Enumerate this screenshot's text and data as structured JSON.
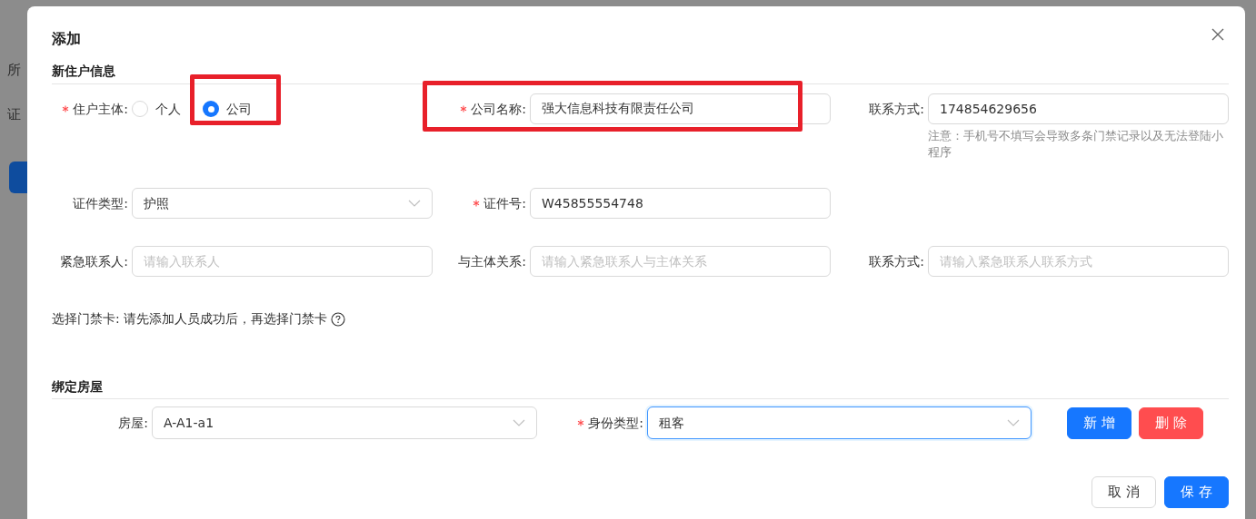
{
  "background": {
    "labels": [
      "所",
      "证"
    ]
  },
  "dialog": {
    "title": "添加",
    "resident": {
      "heading": "新住户信息",
      "rows": [
        [
          {
            "kind": "radio",
            "label": "住户主体:",
            "required": true,
            "options": [
              {
                "label": "个人",
                "selected": false,
                "highlighted": false
              },
              {
                "label": "公司",
                "selected": true,
                "highlighted": true
              }
            ]
          },
          {
            "kind": "input",
            "label": "公司名称:",
            "required": true,
            "value": "强大信息科技有限责任公司",
            "highlighted": true
          },
          {
            "kind": "input",
            "label": "联系方式:",
            "required": false,
            "value": "174854629656",
            "note": "注意：手机号不填写会导致多条门禁记录以及无法登陆小程序",
            "highlighted": false
          }
        ],
        [
          {
            "kind": "select",
            "label": "证件类型:",
            "required": false,
            "value": "护照",
            "highlighted": false
          },
          {
            "kind": "input",
            "label": "证件号:",
            "required": true,
            "value": "W45855554748",
            "highlighted": false
          }
        ],
        [
          {
            "kind": "input",
            "label": "紧急联系人:",
            "required": false,
            "placeholder": "请输入联系人",
            "highlighted": false
          },
          {
            "kind": "input",
            "label": "与主体关系:",
            "required": false,
            "placeholder": "请输入紧急联系人与主体关系",
            "highlighted": false
          },
          {
            "kind": "input",
            "label": "联系方式:",
            "required": false,
            "placeholder": "请输入紧急联系人联系方式",
            "highlighted": false
          }
        ]
      ],
      "door_card": {
        "label": "选择门禁卡:",
        "text": "请先添加人员成功后，再选择门禁卡"
      }
    },
    "binding": {
      "heading": "绑定房屋",
      "house": {
        "label": "房屋:",
        "required": false,
        "value": "A-A1-a1",
        "focused": false
      },
      "identity": {
        "label": "身份类型:",
        "required": true,
        "value": "租客",
        "focused": true
      },
      "buttons": [
        {
          "label": "新 增",
          "kind": "primary"
        },
        {
          "label": "删 除",
          "kind": "danger"
        }
      ]
    },
    "footer": [
      {
        "label": "取 消",
        "kind": "default"
      },
      {
        "label": "保 存",
        "kind": "primary"
      }
    ]
  }
}
